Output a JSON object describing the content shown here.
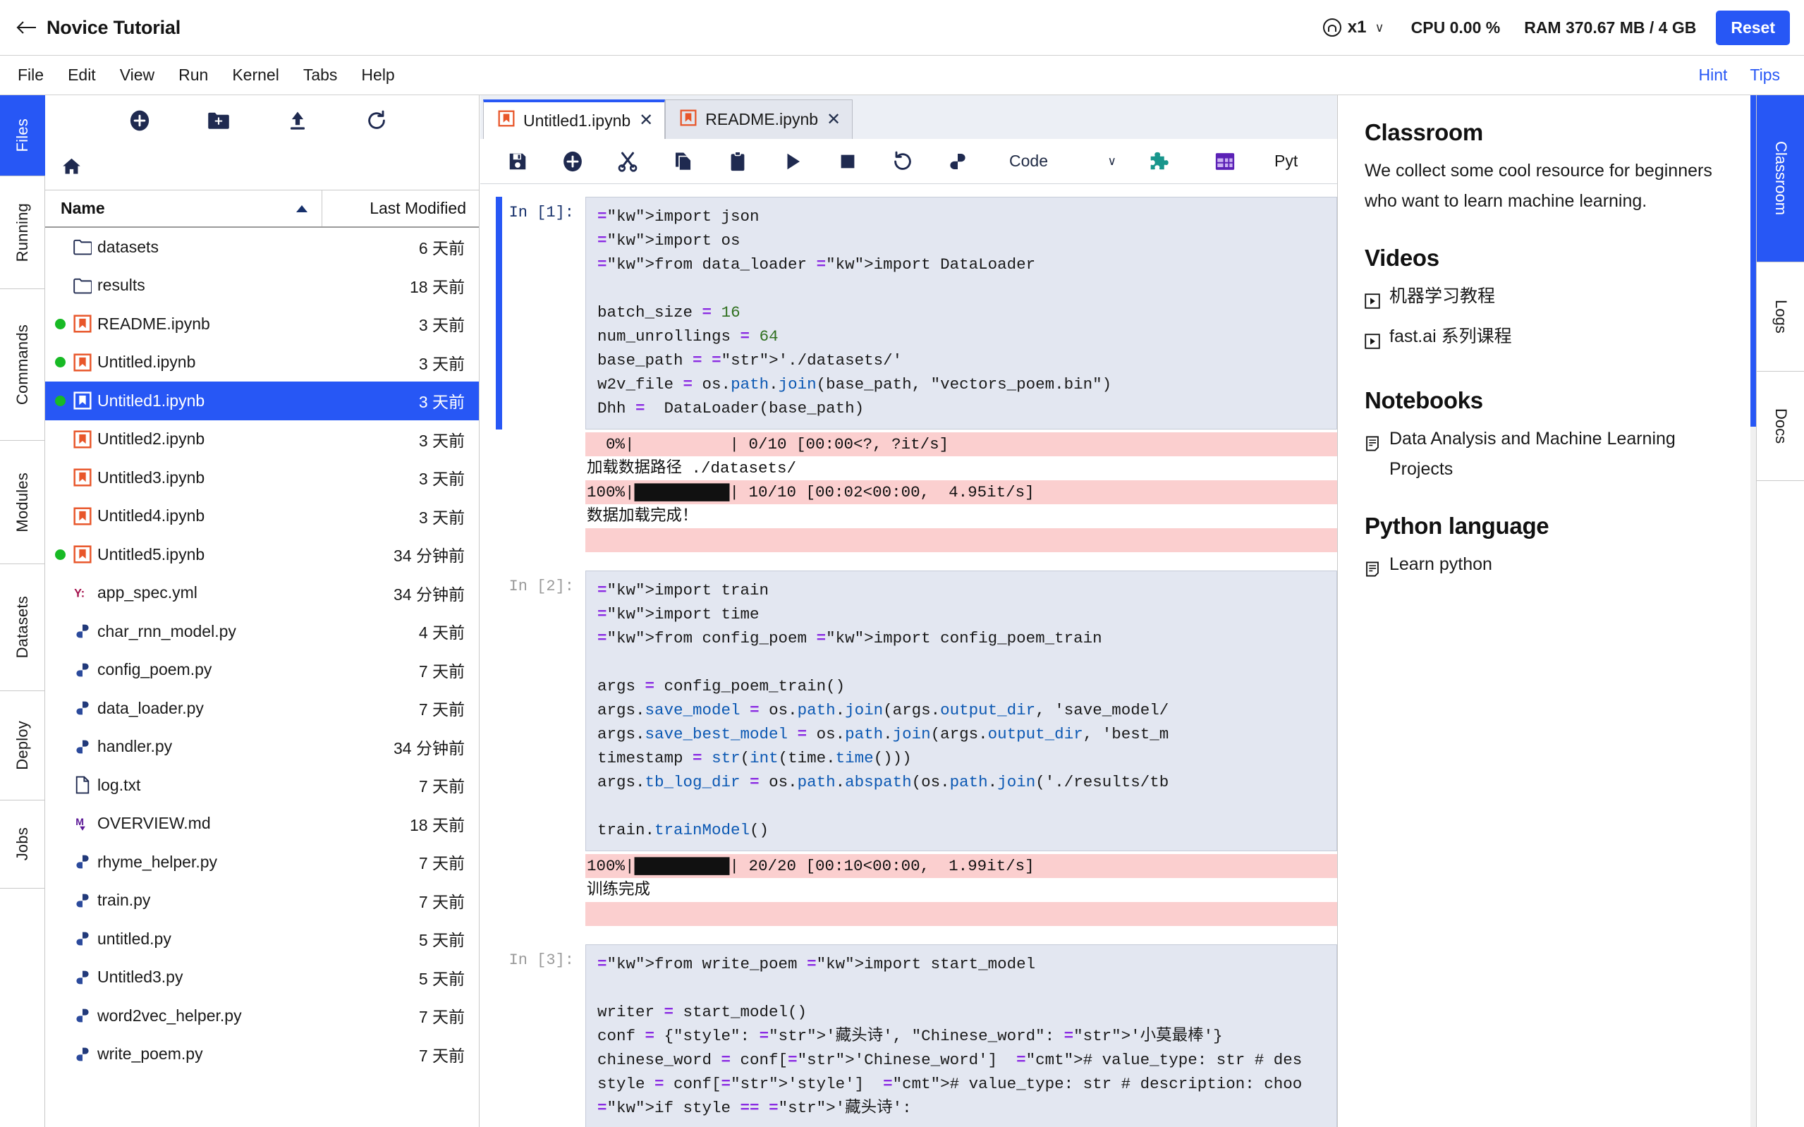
{
  "topbar": {
    "back_icon": "back-arrow-icon",
    "title": "Novice Tutorial",
    "replica_icon": "user-circle-icon",
    "replica_count": "x1",
    "replica_caret": "∨",
    "cpu": "CPU 0.00 %",
    "ram": "RAM 370.67 MB / 4 GB",
    "reset_label": "Reset",
    "accent_color": "#2757f5"
  },
  "menubar": {
    "items": [
      {
        "label": "File"
      },
      {
        "label": "Edit"
      },
      {
        "label": "View"
      },
      {
        "label": "Run"
      },
      {
        "label": "Kernel"
      },
      {
        "label": "Tabs"
      },
      {
        "label": "Help"
      }
    ],
    "right_links": [
      {
        "label": "Hint"
      },
      {
        "label": "Tips"
      }
    ]
  },
  "left_rail": {
    "tabs": [
      {
        "label": "Files",
        "active": true
      },
      {
        "label": "Running",
        "active": false
      },
      {
        "label": "Commands",
        "active": false
      },
      {
        "label": "Modules",
        "active": false
      },
      {
        "label": "Datasets",
        "active": false
      },
      {
        "label": "Deploy",
        "active": false
      },
      {
        "label": "Jobs",
        "active": false
      }
    ]
  },
  "filebrowser": {
    "toolbar": [
      {
        "icon": "new-launcher-icon"
      },
      {
        "icon": "new-folder-icon"
      },
      {
        "icon": "upload-icon"
      },
      {
        "icon": "refresh-icon"
      }
    ],
    "breadcrumb_icon": "home-icon",
    "columns": {
      "name": "Name",
      "last_modified": "Last Modified"
    },
    "sort_indicator": "sort-ascending-icon",
    "rows": [
      {
        "name": "datasets",
        "modified": "6 天前",
        "kind": "folder",
        "running": false,
        "selected": false
      },
      {
        "name": "results",
        "modified": "18 天前",
        "kind": "folder",
        "running": false,
        "selected": false
      },
      {
        "name": "README.ipynb",
        "modified": "3 天前",
        "kind": "notebook",
        "running": true,
        "selected": false
      },
      {
        "name": "Untitled.ipynb",
        "modified": "3 天前",
        "kind": "notebook",
        "running": true,
        "selected": false
      },
      {
        "name": "Untitled1.ipynb",
        "modified": "3 天前",
        "kind": "notebook",
        "running": true,
        "selected": true
      },
      {
        "name": "Untitled2.ipynb",
        "modified": "3 天前",
        "kind": "notebook",
        "running": false,
        "selected": false
      },
      {
        "name": "Untitled3.ipynb",
        "modified": "3 天前",
        "kind": "notebook",
        "running": false,
        "selected": false
      },
      {
        "name": "Untitled4.ipynb",
        "modified": "3 天前",
        "kind": "notebook",
        "running": false,
        "selected": false
      },
      {
        "name": "Untitled5.ipynb",
        "modified": "34 分钟前",
        "kind": "notebook",
        "running": true,
        "selected": false
      },
      {
        "name": "app_spec.yml",
        "modified": "34 分钟前",
        "kind": "yaml",
        "running": false,
        "selected": false
      },
      {
        "name": "char_rnn_model.py",
        "modified": "4 天前",
        "kind": "python",
        "running": false,
        "selected": false
      },
      {
        "name": "config_poem.py",
        "modified": "7 天前",
        "kind": "python",
        "running": false,
        "selected": false
      },
      {
        "name": "data_loader.py",
        "modified": "7 天前",
        "kind": "python",
        "running": false,
        "selected": false
      },
      {
        "name": "handler.py",
        "modified": "34 分钟前",
        "kind": "python",
        "running": false,
        "selected": false
      },
      {
        "name": "log.txt",
        "modified": "7 天前",
        "kind": "text",
        "running": false,
        "selected": false
      },
      {
        "name": "OVERVIEW.md",
        "modified": "18 天前",
        "kind": "markdown",
        "running": false,
        "selected": false
      },
      {
        "name": "rhyme_helper.py",
        "modified": "7 天前",
        "kind": "python",
        "running": false,
        "selected": false
      },
      {
        "name": "train.py",
        "modified": "7 天前",
        "kind": "python",
        "running": false,
        "selected": false
      },
      {
        "name": "untitled.py",
        "modified": "5 天前",
        "kind": "python",
        "running": false,
        "selected": false
      },
      {
        "name": "Untitled3.py",
        "modified": "5 天前",
        "kind": "python",
        "running": false,
        "selected": false
      },
      {
        "name": "word2vec_helper.py",
        "modified": "7 天前",
        "kind": "python",
        "running": false,
        "selected": false
      },
      {
        "name": "write_poem.py",
        "modified": "7 天前",
        "kind": "python",
        "running": false,
        "selected": false
      }
    ]
  },
  "notebook": {
    "tabs": [
      {
        "label": "Untitled1.ipynb",
        "active": true,
        "close": "✕"
      },
      {
        "label": "README.ipynb",
        "active": false,
        "close": "✕"
      }
    ],
    "toolbar": [
      {
        "icon": "save-icon"
      },
      {
        "icon": "insert-cell-below-icon"
      },
      {
        "icon": "cut-icon"
      },
      {
        "icon": "copy-icon"
      },
      {
        "icon": "paste-icon"
      },
      {
        "icon": "run-icon"
      },
      {
        "icon": "stop-icon"
      },
      {
        "icon": "restart-kernel-icon"
      },
      {
        "icon": "restart-and-run-all-icon"
      }
    ],
    "cell_type": "Code",
    "cell_type_caret": "∨",
    "extension_icons": [
      {
        "icon": "puzzle-piece-icon",
        "color": "#18968c"
      },
      {
        "icon": "table-grid-icon",
        "color": "#5b21b6"
      }
    ],
    "kernel_label": "Pyt",
    "cells": [
      {
        "prompt": "In [1]:",
        "selected": true,
        "source": "import json\nimport os\nfrom data_loader import DataLoader\n\nbatch_size = 16\nnum_unrollings = 64\nbase_path = './datasets/'\nw2v_file = os.path.join(base_path, \"vectors_poem.bin\")\nDhh =  DataLoader(base_path)",
        "outputs": [
          {
            "style": "err",
            "text": "  0%|          | 0/10 [00:00<?, ?it/s]"
          },
          {
            "style": "plain",
            "text": "加载数据路径 ./datasets/"
          },
          {
            "style": "err",
            "text": "100%|██████████| 10/10 [00:02<00:00,  4.95it/s]"
          },
          {
            "style": "plain",
            "text": "数据加载完成！"
          },
          {
            "style": "err",
            "text": " "
          }
        ]
      },
      {
        "prompt": "In [2]:",
        "selected": false,
        "source": "import train\nimport time\nfrom config_poem import config_poem_train\n\nargs = config_poem_train()\nargs.save_model = os.path.join(args.output_dir, 'save_model/\nargs.save_best_model = os.path.join(args.output_dir, 'best_m\ntimestamp = str(int(time.time()))\nargs.tb_log_dir = os.path.abspath(os.path.join('./results/tb\n\ntrain.trainModel()",
        "outputs": [
          {
            "style": "err",
            "text": "100%|██████████| 20/20 [00:10<00:00,  1.99it/s]"
          },
          {
            "style": "plain",
            "text": "训练完成"
          },
          {
            "style": "err",
            "text": " "
          }
        ]
      },
      {
        "prompt": "In [3]:",
        "selected": false,
        "source": "from write_poem import start_model\n\nwriter = start_model()\nconf = {\"style\": '藏头诗', \"Chinese_word\": '小莫最棒'}\nchinese_word = conf['Chinese_word']  # value_type: str # des\nstyle = conf['style']  # value_type: str # description: choo\nif style == '藏头诗':",
        "outputs": []
      }
    ]
  },
  "classroom": {
    "sections": [
      {
        "heading": "Classroom",
        "paragraph": "We collect some cool resource for beginners who want to learn machine learning.",
        "links": []
      },
      {
        "heading": "Videos",
        "paragraph": "",
        "links": [
          {
            "icon": "play-square-icon",
            "label": "机器学习教程"
          },
          {
            "icon": "play-square-icon",
            "label": "fast.ai 系列课程"
          }
        ]
      },
      {
        "heading": "Notebooks",
        "paragraph": "",
        "links": [
          {
            "icon": "notebook-page-icon",
            "label": "Data Analysis and Machine Learning Projects"
          }
        ]
      },
      {
        "heading": "Python language",
        "paragraph": "",
        "links": [
          {
            "icon": "notebook-page-icon",
            "label": "Learn python"
          }
        ]
      }
    ]
  },
  "right_rail": {
    "tabs": [
      {
        "label": "Classroom",
        "active": true
      },
      {
        "label": "Logs",
        "active": false
      },
      {
        "label": "Docs",
        "active": false
      }
    ]
  }
}
